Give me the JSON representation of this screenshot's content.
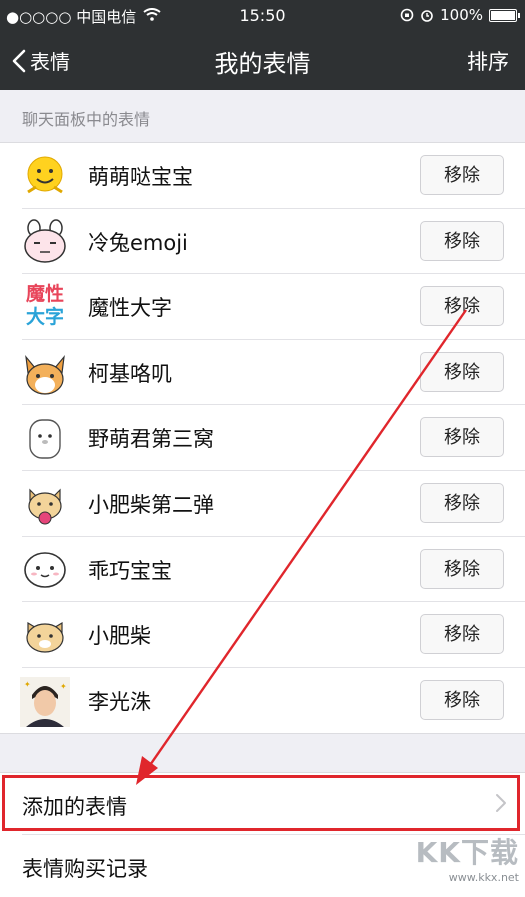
{
  "status_bar": {
    "carrier": "●○○○○ 中国电信",
    "time": "15:50",
    "battery": "100%"
  },
  "nav": {
    "back_label": "表情",
    "title": "我的表情",
    "sort_label": "排序"
  },
  "section_header": "聊天面板中的表情",
  "stickers": [
    {
      "name": "萌萌哒宝宝",
      "remove_label": "移除"
    },
    {
      "name": "冷兔emoji",
      "remove_label": "移除"
    },
    {
      "name": "魔性大字",
      "remove_label": "移除"
    },
    {
      "name": "柯基咯叽",
      "remove_label": "移除"
    },
    {
      "name": "野萌君第三窝",
      "remove_label": "移除"
    },
    {
      "name": "小肥柴第二弹",
      "remove_label": "移除"
    },
    {
      "name": "乖巧宝宝",
      "remove_label": "移除"
    },
    {
      "name": "小肥柴",
      "remove_label": "移除"
    },
    {
      "name": "李光洙",
      "remove_label": "移除"
    }
  ],
  "thumb_text": {
    "mxdz_top": "魔性",
    "mxdz_bottom": "大字"
  },
  "menu": {
    "added_stickers": "添加的表情",
    "purchase_history": "表情购买记录"
  },
  "watermark": {
    "logo": "KK下载",
    "url": "www.kkx.net"
  },
  "colors": {
    "nav_bg": "#2e3133",
    "highlight": "#e0262c",
    "background": "#efeff4"
  }
}
